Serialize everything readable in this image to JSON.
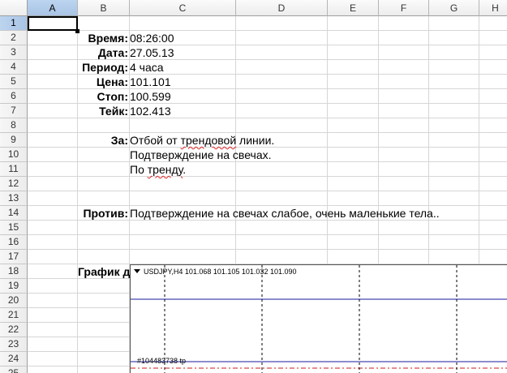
{
  "columns": [
    "A",
    "B",
    "C",
    "D",
    "E",
    "F",
    "G",
    "H"
  ],
  "rows": [
    "1",
    "2",
    "3",
    "4",
    "5",
    "6",
    "7",
    "8",
    "9",
    "10",
    "11",
    "12",
    "13",
    "14",
    "15",
    "16",
    "17",
    "18",
    "19",
    "20",
    "21",
    "22",
    "23",
    "24",
    "25"
  ],
  "selected_cell": "A1",
  "fields": {
    "time": {
      "label": "Время:",
      "value": "08:26:00"
    },
    "date": {
      "label": "Дата:",
      "value": "27.05.13"
    },
    "period": {
      "label": "Период:",
      "value": "4 часа"
    },
    "price": {
      "label": "Цена:",
      "value": "101.101"
    },
    "stop": {
      "label": "Стоп:",
      "value": "100.599"
    },
    "take": {
      "label": "Тейк:",
      "value": "102.413"
    }
  },
  "pro": {
    "label": "За:",
    "line1_a": "Отбой от ",
    "line1_b": "трендовой",
    "line1_c": " линии.",
    "line2": "Подтверждение на свечах.",
    "line3_a": "По ",
    "line3_b": "тренду",
    "line3_c": "."
  },
  "contra": {
    "label": "Против:",
    "text": "Подтверждение на свечах слабое, очень маленькие тела.."
  },
  "chart": {
    "label": "График до:",
    "header": "USDJPY,H4  101.068 101.105 101.032 101.090",
    "order_label": "#104483738 tp",
    "line_color": "#1a1a9c",
    "order_line_color": "#d11a1a"
  }
}
